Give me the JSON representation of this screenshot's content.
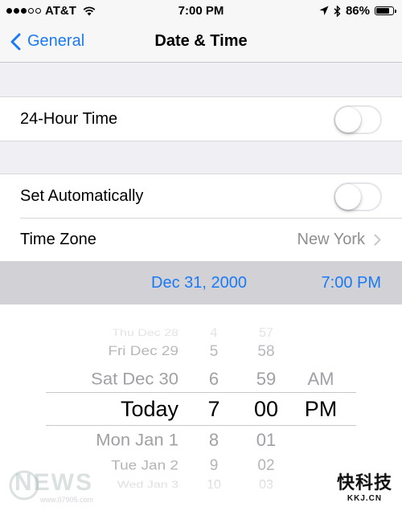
{
  "status_bar": {
    "carrier": "AT&T",
    "time": "7:00 PM",
    "battery_percent": "86%",
    "battery_level": 0.86,
    "signal_bars_filled": 3,
    "signal_bars_total": 5
  },
  "nav": {
    "back_label": "General",
    "title": "Date & Time"
  },
  "settings": {
    "hour24": {
      "label": "24-Hour Time",
      "on": false
    },
    "set_automatically": {
      "label": "Set Automatically",
      "on": false
    },
    "time_zone": {
      "label": "Time Zone",
      "value": "New York"
    }
  },
  "selected": {
    "date": "Dec 31, 2000",
    "time": "7:00 PM"
  },
  "picker": {
    "date_column": {
      "above": [
        "Thu Dec 28",
        "Fri Dec 29",
        "Sat Dec 30"
      ],
      "selected": "Today",
      "below": [
        "Mon Jan 1",
        "Tue Jan 2",
        "Wed Jan 3"
      ]
    },
    "hour_column": {
      "above": [
        "4",
        "5",
        "6"
      ],
      "selected": "7",
      "below": [
        "8",
        "9",
        "10"
      ]
    },
    "minute_column": {
      "above": [
        "57",
        "58",
        "59"
      ],
      "selected": "00",
      "below": [
        "01",
        "02",
        "03"
      ]
    },
    "ampm_column": {
      "above": [
        "AM"
      ],
      "selected": "PM"
    }
  },
  "watermarks": {
    "left_logo": "NEWS",
    "left_url": "www.07905.com",
    "right_logo": "快科技",
    "right_url": "KKJ.CN"
  },
  "colors": {
    "accent": "#1a7af5",
    "background": "#efeff4",
    "detail_gray": "#8e8e93",
    "selected_row_bg": "#d1d1d6"
  }
}
